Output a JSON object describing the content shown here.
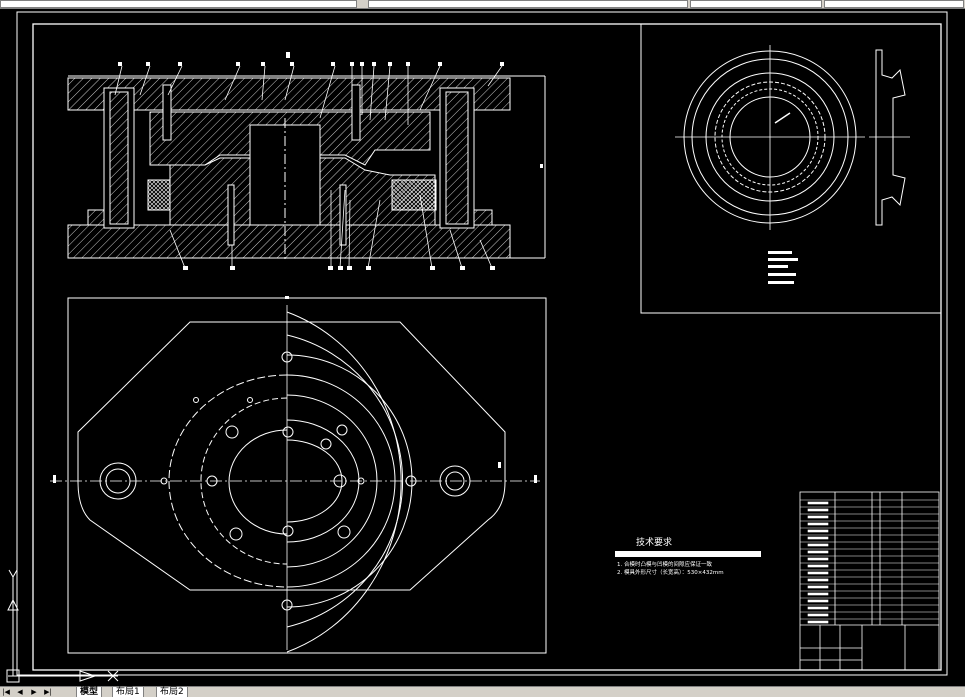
{
  "tech": {
    "heading": "技术要求",
    "line1": "1. 合模时凸模与凹模的间隙应保证一致",
    "line2": "2. 模具外形尺寸（长宽高）：530×432mm"
  },
  "tabs": {
    "model": "模型",
    "layout1": "布局1",
    "layout2": "布局2"
  },
  "colors": {
    "background": "#000000",
    "linework": "#ffffff",
    "ui_gray": "#d4d0c8"
  }
}
